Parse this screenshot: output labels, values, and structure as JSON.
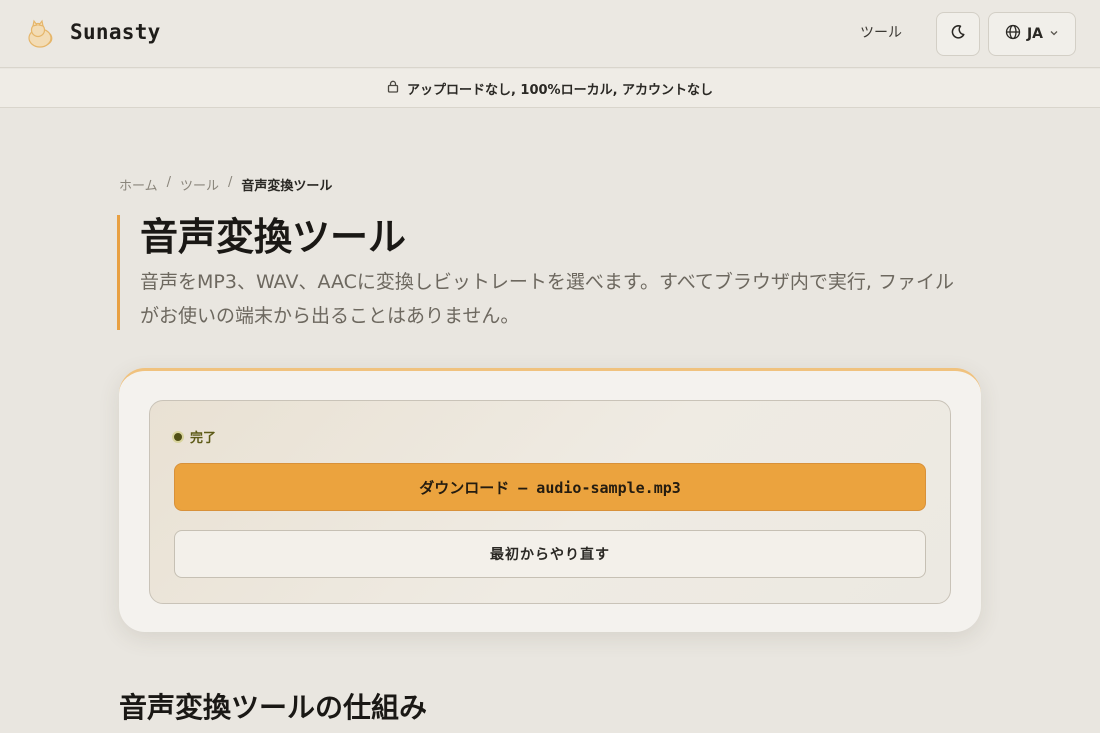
{
  "header": {
    "brand": "Sunasty",
    "logo_icon": "cat-icon",
    "nav_tools": "ツール",
    "theme_icon": "moon-icon",
    "lang_icon": "globe-icon",
    "lang_label": "JA",
    "lang_chevron_icon": "chevron-down-icon"
  },
  "banner": {
    "icon": "lock-icon",
    "text": "アップロードなし, 100%ローカル, アカウントなし"
  },
  "breadcrumb": {
    "home": "ホーム",
    "tools": "ツール",
    "current": "音声変換ツール",
    "separator": "/"
  },
  "hero": {
    "title": "音声変換ツール",
    "description": "音声をMP3、WAV、AACに変換しビットレートを選べます。すべてブラウザ内で実行, ファイルがお使いの端末から出ることはありません。"
  },
  "result": {
    "status": "完了",
    "download_label": "ダウンロード — audio-sample.mp3",
    "restart_label": "最初からやり直す"
  },
  "section": {
    "title": "音声変換ツールの仕組み"
  },
  "colors": {
    "accent": "#eba33e",
    "status_dot": "#515015",
    "background": "#e9e6e0"
  }
}
